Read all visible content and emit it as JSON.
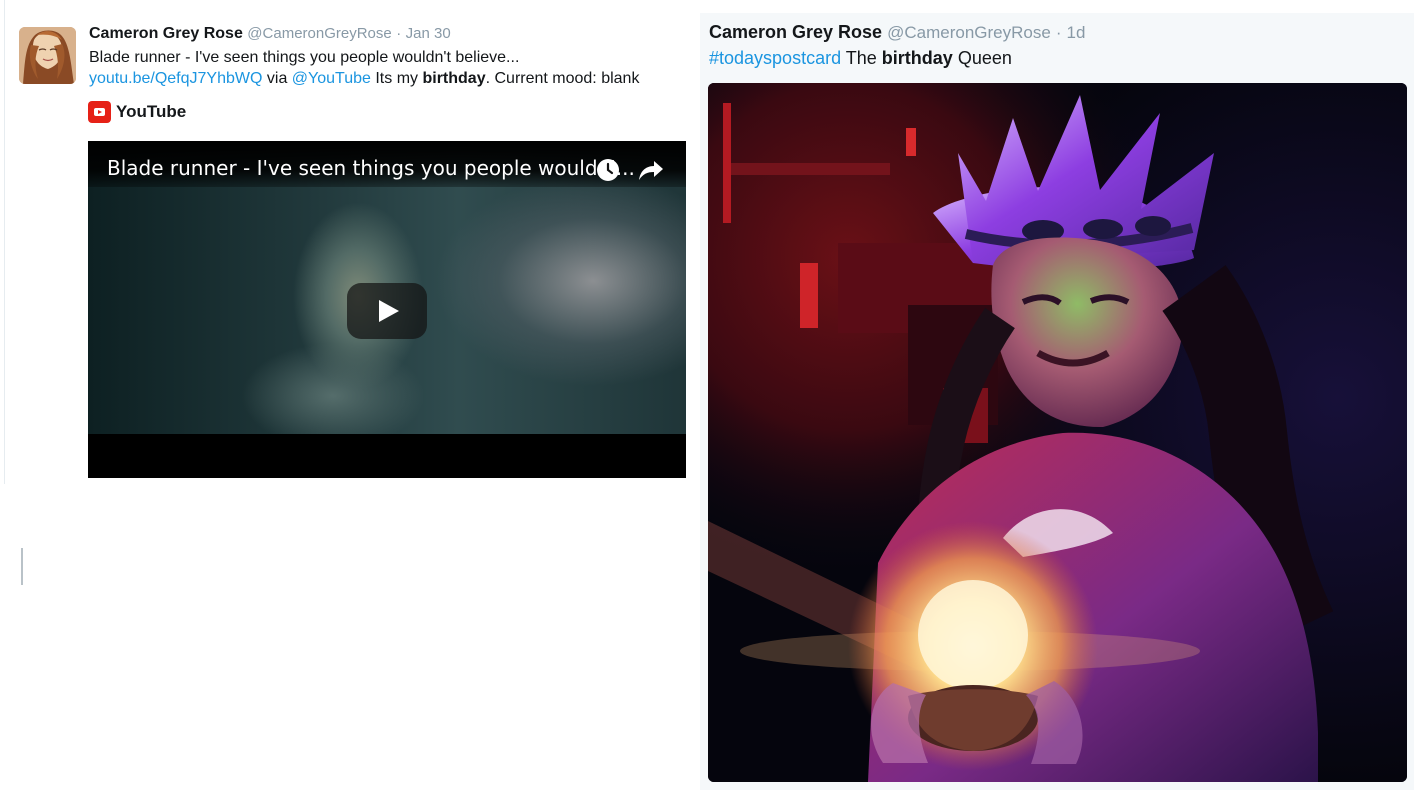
{
  "colors": {
    "link": "#1b95e0",
    "handle": "#8899a6",
    "text": "#14171a",
    "youtube_red": "#e62117"
  },
  "tweet_left": {
    "author_name": "Cameron Grey Rose",
    "handle": "@CameronGreyRose",
    "separator": "·",
    "timestamp": "Jan 30",
    "text_line1": "Blade runner - I've seen things you people wouldn't believe...",
    "link": "youtu.be/QefqJ7YhbWQ",
    "via": " via ",
    "mention": "@YouTube",
    "text_after_mention": " Its my ",
    "bold_word": "birthday",
    "text_end": ". Current mood: blank",
    "card": {
      "source_label": "YouTube",
      "video_title": "Blade runner - I've seen things you people wouldn'...",
      "icons": [
        "youtube-icon",
        "clock-icon",
        "share-icon",
        "play-icon"
      ]
    }
  },
  "tweet_right": {
    "author_name": "Cameron Grey Rose",
    "handle": "@CameronGreyRose",
    "separator": "·",
    "timestamp": "1d",
    "hashtag": "#todayspostcard",
    "text_before_bold": " The ",
    "bold_word": "birthday",
    "text_after_bold": " Queen"
  }
}
